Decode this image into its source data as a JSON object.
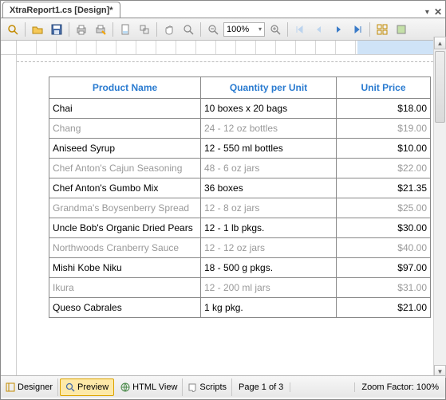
{
  "tab": {
    "title": "XtraReport1.cs [Design]*"
  },
  "toolbar": {
    "zoom_value": "100%"
  },
  "table": {
    "headers": {
      "name": "Product Name",
      "qty": "Quantity per Unit",
      "price": "Unit Price"
    },
    "rows": [
      {
        "name": "Chai",
        "qty": "10 boxes x 20 bags",
        "price": "$18.00",
        "dim": false
      },
      {
        "name": "Chang",
        "qty": "24 - 12 oz bottles",
        "price": "$19.00",
        "dim": true
      },
      {
        "name": "Aniseed Syrup",
        "qty": "12 - 550 ml bottles",
        "price": "$10.00",
        "dim": false
      },
      {
        "name": "Chef Anton's Cajun Seasoning",
        "qty": "48 - 6 oz jars",
        "price": "$22.00",
        "dim": true
      },
      {
        "name": "Chef Anton's Gumbo Mix",
        "qty": "36 boxes",
        "price": "$21.35",
        "dim": false
      },
      {
        "name": "Grandma's Boysenberry Spread",
        "qty": "12 - 8 oz jars",
        "price": "$25.00",
        "dim": true
      },
      {
        "name": "Uncle Bob's Organic Dried Pears",
        "qty": "12 - 1 lb pkgs.",
        "price": "$30.00",
        "dim": false
      },
      {
        "name": "Northwoods Cranberry Sauce",
        "qty": "12 - 12 oz jars",
        "price": "$40.00",
        "dim": true
      },
      {
        "name": "Mishi Kobe Niku",
        "qty": "18 - 500 g pkgs.",
        "price": "$97.00",
        "dim": false
      },
      {
        "name": "Ikura",
        "qty": "12 - 200 ml jars",
        "price": "$31.00",
        "dim": true
      },
      {
        "name": "Queso Cabrales",
        "qty": "1 kg pkg.",
        "price": "$21.00",
        "dim": false
      }
    ]
  },
  "status": {
    "designer": "Designer",
    "preview": "Preview",
    "htmlview": "HTML View",
    "scripts": "Scripts",
    "page": "Page 1 of 3",
    "zoom": "Zoom Factor: 100%"
  }
}
